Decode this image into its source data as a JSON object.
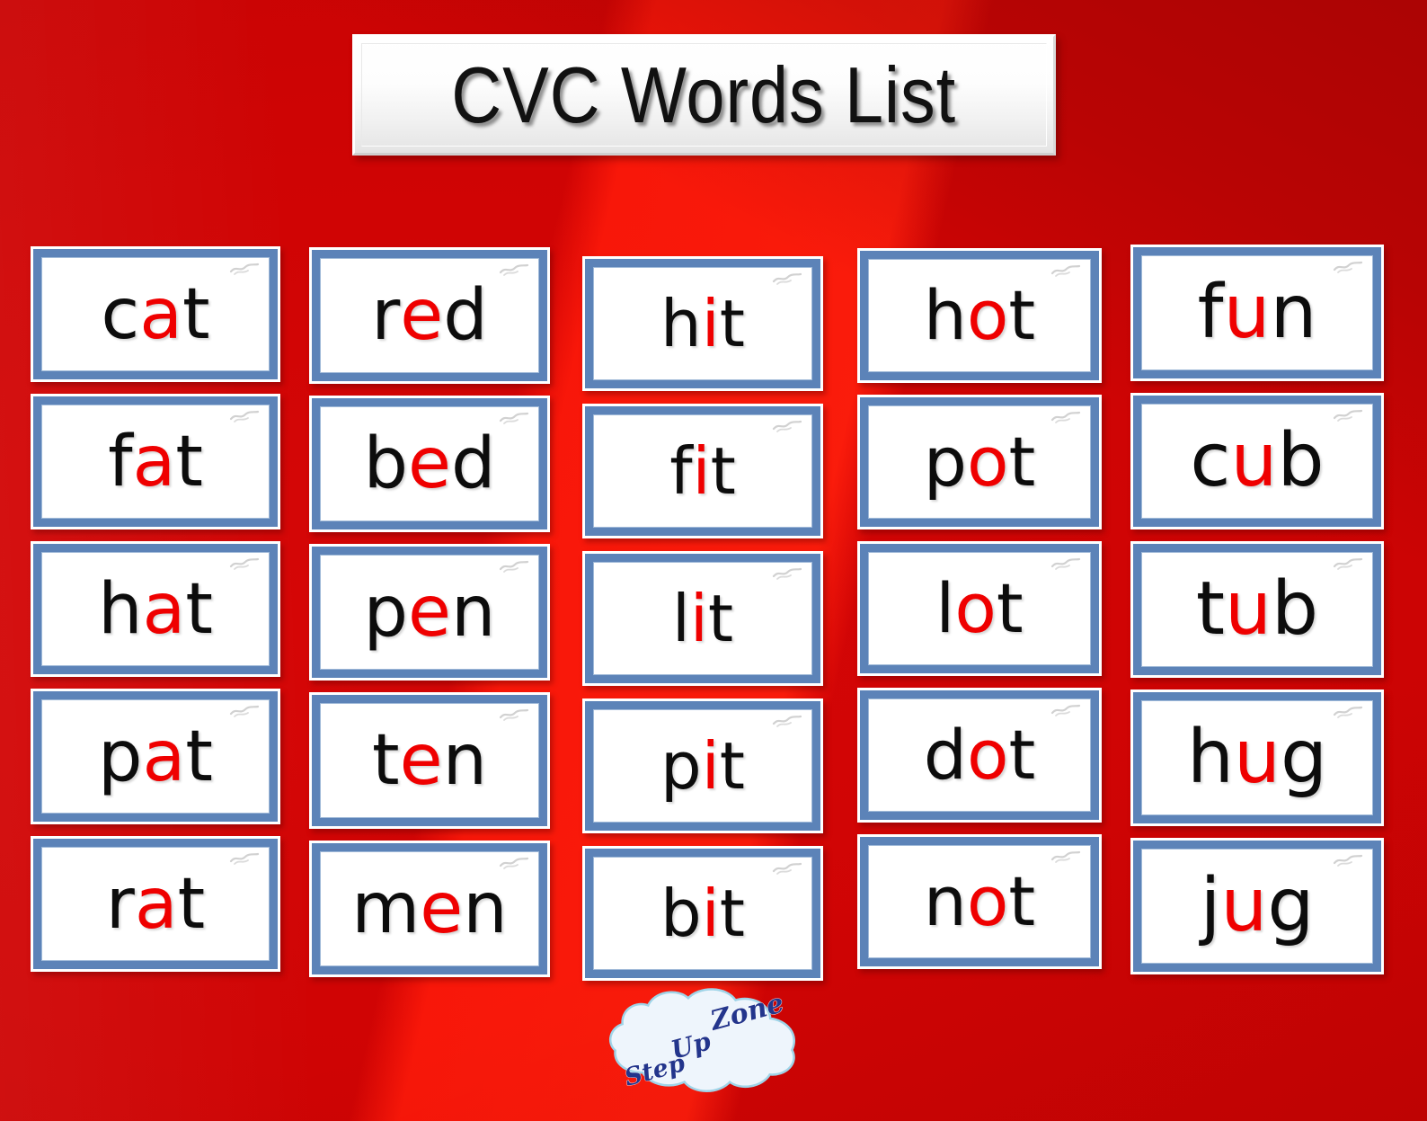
{
  "page": {
    "title": "CVC Words List",
    "background_color": "#cf0404",
    "accent_red": "#ef0000",
    "card_border_blue": "#5c83b8",
    "card_background": "#ffffff"
  },
  "logo": {
    "line1": "Zone",
    "line2": "Up",
    "line3": "Step",
    "cloud_fill": "#e8f1fb",
    "cloud_edge": "#9fd4e8",
    "text_color": "#23358c"
  },
  "columns": [
    {
      "name": "short-a",
      "vowel": "a",
      "cards": [
        {
          "word": "cat",
          "before": "c",
          "vowel": "a",
          "after": "t"
        },
        {
          "word": "fat",
          "before": "f",
          "vowel": "a",
          "after": "t"
        },
        {
          "word": "hat",
          "before": "h",
          "vowel": "a",
          "after": "t"
        },
        {
          "word": "pat",
          "before": "p",
          "vowel": "a",
          "after": "t"
        },
        {
          "word": "rat",
          "before": "r",
          "vowel": "a",
          "after": "t"
        }
      ]
    },
    {
      "name": "short-e",
      "vowel": "e",
      "cards": [
        {
          "word": "red",
          "before": "r",
          "vowel": "e",
          "after": "d"
        },
        {
          "word": "bed",
          "before": "b",
          "vowel": "e",
          "after": "d"
        },
        {
          "word": "pen",
          "before": "p",
          "vowel": "e",
          "after": "n"
        },
        {
          "word": "ten",
          "before": "t",
          "vowel": "e",
          "after": "n"
        },
        {
          "word": "men",
          "before": "m",
          "vowel": "e",
          "after": "n"
        }
      ]
    },
    {
      "name": "short-i",
      "vowel": "i",
      "cards": [
        {
          "word": "hit",
          "before": "h",
          "vowel": "i",
          "after": "t"
        },
        {
          "word": "fit",
          "before": "f",
          "vowel": "i",
          "after": "t"
        },
        {
          "word": "lit",
          "before": "l",
          "vowel": "i",
          "after": "t"
        },
        {
          "word": "pit",
          "before": "p",
          "vowel": "i",
          "after": "t"
        },
        {
          "word": "bit",
          "before": "b",
          "vowel": "i",
          "after": "t"
        }
      ]
    },
    {
      "name": "short-o",
      "vowel": "o",
      "cards": [
        {
          "word": "hot",
          "before": "h",
          "vowel": "o",
          "after": "t"
        },
        {
          "word": "pot",
          "before": "p",
          "vowel": "o",
          "after": "t"
        },
        {
          "word": "lot",
          "before": "l",
          "vowel": "o",
          "after": "t"
        },
        {
          "word": "dot",
          "before": "d",
          "vowel": "o",
          "after": "t"
        },
        {
          "word": "not",
          "before": "n",
          "vowel": "o",
          "after": "t"
        }
      ]
    },
    {
      "name": "short-u",
      "vowel": "u",
      "cards": [
        {
          "word": "fun",
          "before": "f",
          "vowel": "u",
          "after": "n"
        },
        {
          "word": "cub",
          "before": "c",
          "vowel": "u",
          "after": "b"
        },
        {
          "word": "tub",
          "before": "t",
          "vowel": "u",
          "after": "b"
        },
        {
          "word": "hug",
          "before": "h",
          "vowel": "u",
          "after": "g"
        },
        {
          "word": "jug",
          "before": "j",
          "vowel": "u",
          "after": "g"
        }
      ]
    }
  ]
}
